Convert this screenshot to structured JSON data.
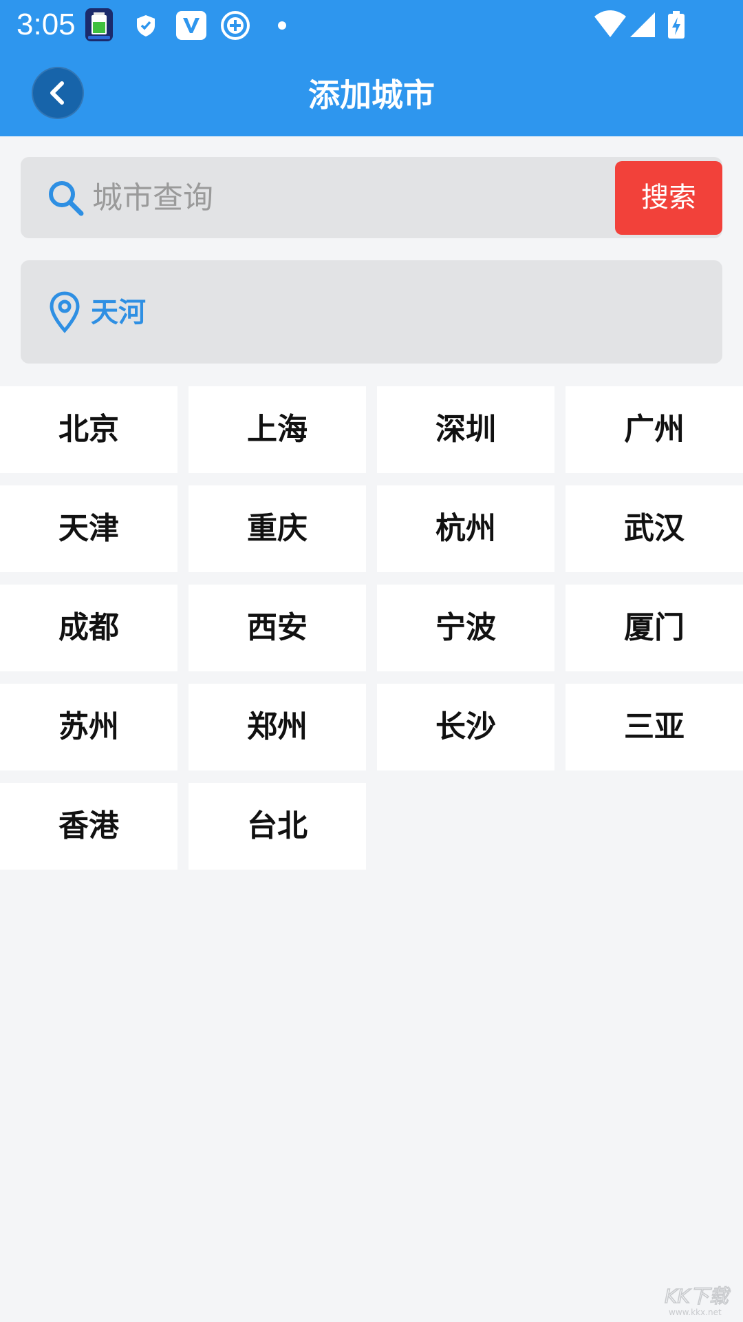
{
  "status_bar": {
    "time": "3:05",
    "icons": [
      "battery-app-icon",
      "shield-icon",
      "v-app-icon",
      "add-circle-icon",
      "notification-dot-icon",
      "wifi-icon",
      "signal-icon",
      "battery-charging-icon"
    ]
  },
  "header": {
    "title": "添加城市",
    "back_icon": "chevron-left-icon",
    "background": "#2e96ee"
  },
  "search": {
    "placeholder": "城市查询",
    "value": "",
    "button_label": "搜索",
    "icon": "search-icon",
    "button_color": "#f2413a"
  },
  "location": {
    "icon": "map-pin-icon",
    "label": "天河",
    "color": "#2e8fe3"
  },
  "cities": [
    "北京",
    "上海",
    "深圳",
    "广州",
    "天津",
    "重庆",
    "杭州",
    "武汉",
    "成都",
    "西安",
    "宁波",
    "厦门",
    "苏州",
    "郑州",
    "长沙",
    "三亚",
    "香港",
    "台北"
  ],
  "watermark": {
    "text": "KK下载",
    "subtext": "www.kkx.net"
  }
}
